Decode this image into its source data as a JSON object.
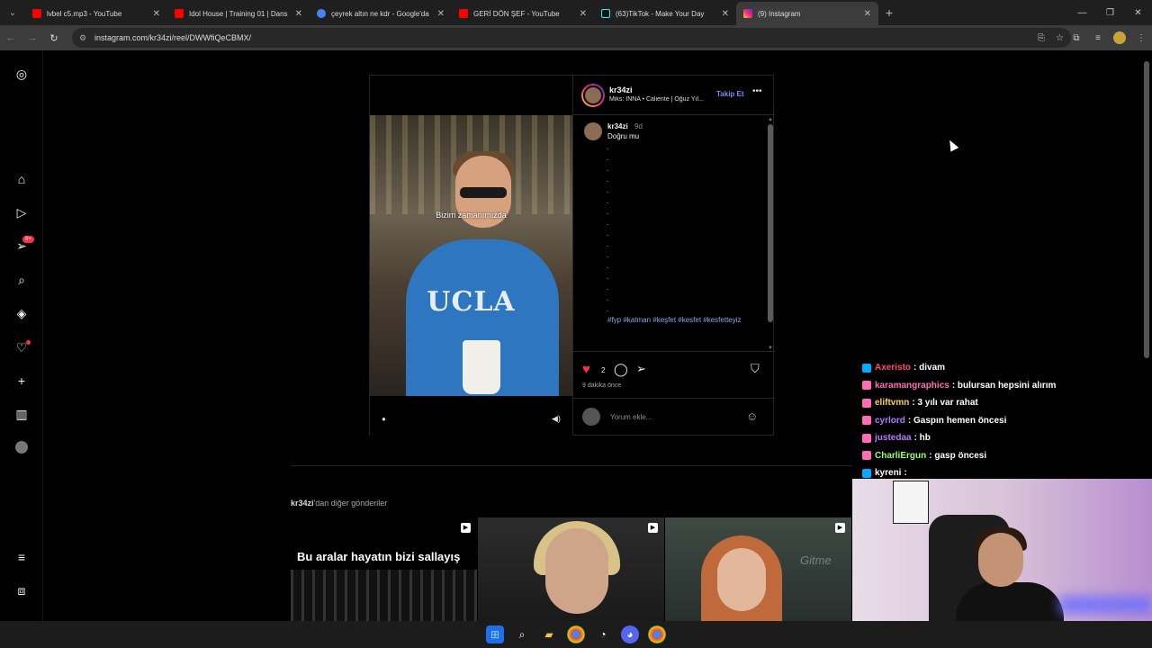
{
  "browser": {
    "tabs": [
      {
        "title": "lvbel c5.mp3 - YouTube",
        "favicon_color": "#ff0000"
      },
      {
        "title": "Idol House | Training 01 | Dans",
        "favicon_color": "#ff0000"
      },
      {
        "title": "çeyrek altın ne kdr - Google'da",
        "favicon_color": "#4285f4"
      },
      {
        "title": "GERİ DÖN ŞEF - YouTube",
        "favicon_color": "#ff0000"
      },
      {
        "title": "(63)TikTok - Make Your Day",
        "favicon_color": "#25f4ee"
      },
      {
        "title": "(9) Instagram",
        "favicon_color": "#e1306c"
      }
    ],
    "url": "instagram.com/kr34zi/reel/DWWfiQeCBMX/"
  },
  "post": {
    "username": "kr34zi",
    "music": "Miks: INNA • Caliente | Oğuz Yıl...",
    "follow_label": "Takip Et",
    "video_caption": "Bizim zamanımızda",
    "shirt_text": "UCLA",
    "comment": {
      "username": "kr34zi",
      "time": "9d",
      "text": "Doğru mu",
      "dots": [
        ".",
        ".",
        ".",
        ".",
        ".",
        ".",
        ".",
        ".",
        ".",
        ".",
        ".",
        ".",
        ".",
        ".",
        ".",
        "."
      ],
      "tags": "#fyp #katman #keşfet #kesfet #kesfetteyiz"
    },
    "likes": "2",
    "timestamp": "9 dakika önce",
    "add_comment_placeholder": "Yorum ekle..."
  },
  "more_posts": {
    "owner": "kr34zi",
    "suffix": "'dan diğer gönderiler",
    "thumb1_caption": "Bu aralar hayatın bizi sallayış",
    "thumb3_wall_text": "Gitme"
  },
  "sidebar": {
    "notification_badge": "9+"
  },
  "chat": [
    {
      "name": "Axeristo",
      "text": ": divam",
      "color": "#ff4a6e",
      "badge_color": "#00aaff"
    },
    {
      "name": "karamangraphics",
      "text": ": bulursan hepsini alırım",
      "color": "#ff6eb4",
      "badge_color": "#ff6eb4"
    },
    {
      "name": "eliftvmn",
      "text": ": 3 yılı var rahat",
      "color": "#ffd24a",
      "badge_color": "#ff6eb4"
    },
    {
      "name": "cyrlord",
      "text": ": Gaspın hemen öncesi",
      "color": "#b57bff",
      "badge_color": "#ff6eb4"
    },
    {
      "name": "justedaa",
      "text": ": hb",
      "color": "#b57bff",
      "badge_color": "#ff6eb4"
    },
    {
      "name": "CharliErgun",
      "text": ": gasp öncesi",
      "color": "#9dff6b",
      "badge_color": "#ff6eb4"
    },
    {
      "name": "kyreni",
      "text": ":",
      "color": "#ffffff",
      "badge_color": "#00aaff"
    }
  ]
}
